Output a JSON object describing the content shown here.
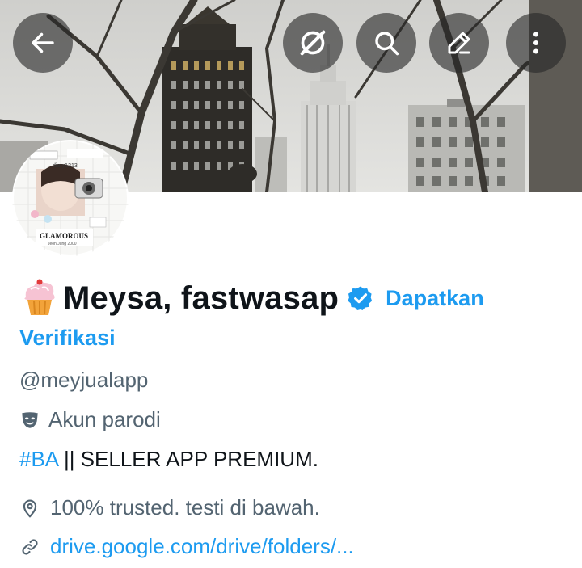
{
  "header": {
    "buttons": [
      {
        "name": "back",
        "icon": "arrow-left-icon"
      },
      {
        "name": "grok",
        "icon": "grok-icon"
      },
      {
        "name": "search",
        "icon": "search-icon"
      },
      {
        "name": "edit",
        "icon": "pencil-icon"
      },
      {
        "name": "more",
        "icon": "more-vertical-icon"
      }
    ]
  },
  "avatar": {
    "caption": "GLAMOROUS",
    "subcaption": "Jeon Jung 2000",
    "sticker": "diary1313"
  },
  "profile": {
    "emoji": "🧁",
    "display_name": "Meysa, fastwasap",
    "get_verified_line1": "Dapatkan",
    "get_verified_line2": "Verifikasi",
    "handle": "@meyjualapp",
    "parody_label": "Akun parodi",
    "bio_hashtag": "#BA",
    "bio_text": " || SELLER APP PREMIUM.",
    "location": "100% trusted. testi di bawah.",
    "link": "drive.google.com/drive/folders/..."
  },
  "colors": {
    "accent": "#1d9bf0",
    "text_primary": "#0f1419",
    "text_secondary": "#536471"
  }
}
